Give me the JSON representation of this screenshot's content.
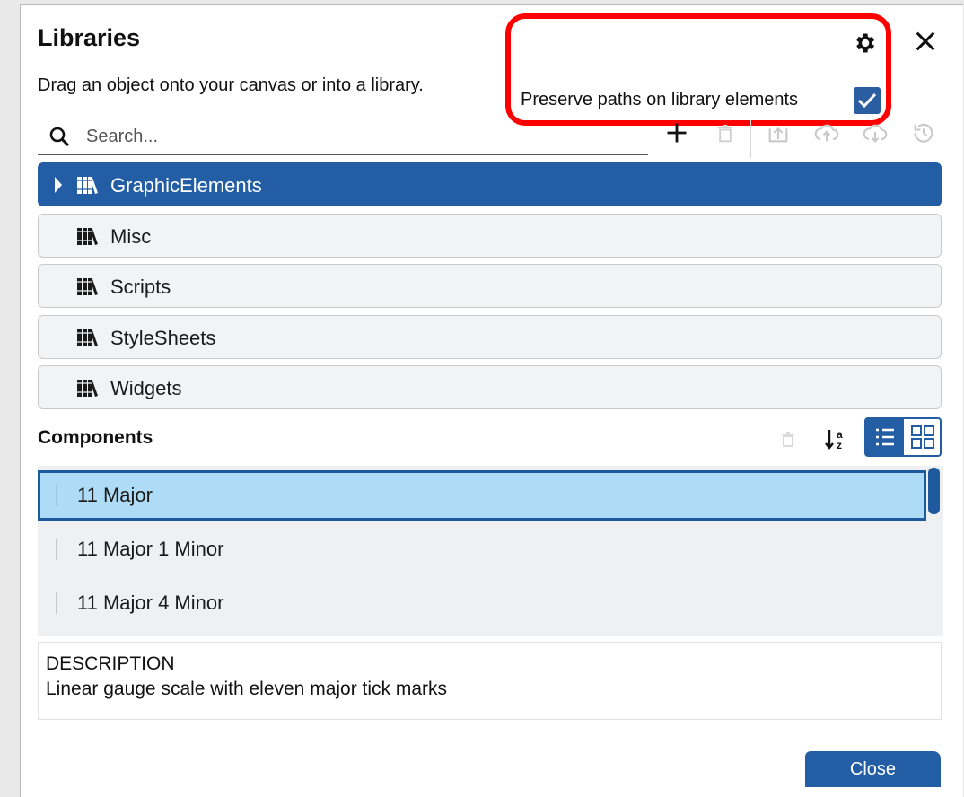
{
  "dialog": {
    "title": "Libraries",
    "subtitle": "Drag an object onto your canvas or into a library.",
    "preserve_label": "Preserve paths on library elements",
    "preserve_checked": true
  },
  "search": {
    "placeholder": "Search...",
    "value": ""
  },
  "toolbar_icons": [
    "plus-icon",
    "trash-icon",
    "upload-icon",
    "cloud-upload-icon",
    "cloud-download-icon",
    "history-icon"
  ],
  "libraries": [
    {
      "label": "GraphicElements",
      "selected": true
    },
    {
      "label": "Misc",
      "selected": false
    },
    {
      "label": "Scripts",
      "selected": false
    },
    {
      "label": "StyleSheets",
      "selected": false
    },
    {
      "label": "Widgets",
      "selected": false
    }
  ],
  "components": {
    "title": "Components",
    "items": [
      {
        "label": "11 Major",
        "selected": true
      },
      {
        "label": "11 Major 1 Minor",
        "selected": false
      },
      {
        "label": "11 Major 4 Minor",
        "selected": false
      }
    ],
    "view_mode": "list"
  },
  "description": {
    "title": "DESCRIPTION",
    "text": "Linear gauge scale with eleven major tick marks"
  },
  "close_button": "Close",
  "colors": {
    "accent": "#235ea5",
    "highlight": "#ff0000",
    "selected_row": "#aedcf6"
  }
}
